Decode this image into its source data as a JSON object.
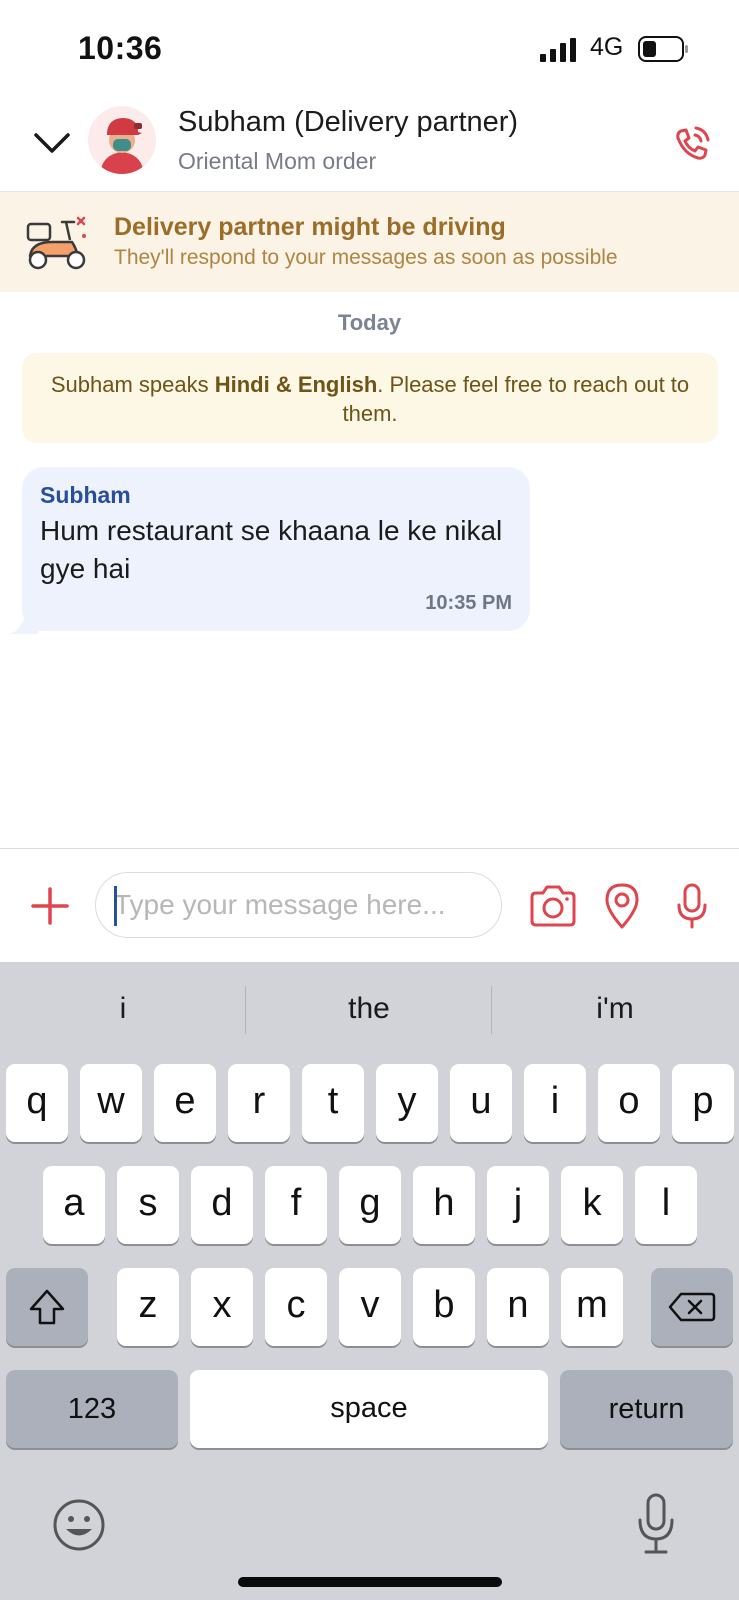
{
  "status_bar": {
    "time": "10:36",
    "network": "4G"
  },
  "header": {
    "title": "Subham (Delivery partner)",
    "subtitle": "Oriental Mom order"
  },
  "banner": {
    "title": "Delivery partner might be driving",
    "subtitle": "They'll respond to your messages as soon as possible"
  },
  "chat": {
    "date_label": "Today",
    "language_note": {
      "prefix": "Subham speaks ",
      "languages": "Hindi & English",
      "suffix": ". Please feel free to reach out to them."
    },
    "messages": [
      {
        "sender": "Subham",
        "text": "Hum restaurant se khaana le ke nikal gye hai",
        "time": "10:35 PM"
      }
    ]
  },
  "composer": {
    "placeholder": "Type your message here..."
  },
  "keyboard": {
    "suggestions": [
      "i",
      "the",
      "i'm"
    ],
    "row1": [
      "q",
      "w",
      "e",
      "r",
      "t",
      "y",
      "u",
      "i",
      "o",
      "p"
    ],
    "row2": [
      "a",
      "s",
      "d",
      "f",
      "g",
      "h",
      "j",
      "k",
      "l"
    ],
    "row3": [
      "z",
      "x",
      "c",
      "v",
      "b",
      "n",
      "m"
    ],
    "numbers_label": "123",
    "space_label": "space",
    "return_label": "return"
  },
  "colors": {
    "accent": "#e0444e",
    "banner_bg": "#fbf3e6",
    "bubble_bg": "#edf2fd",
    "sender": "#284e9c"
  }
}
